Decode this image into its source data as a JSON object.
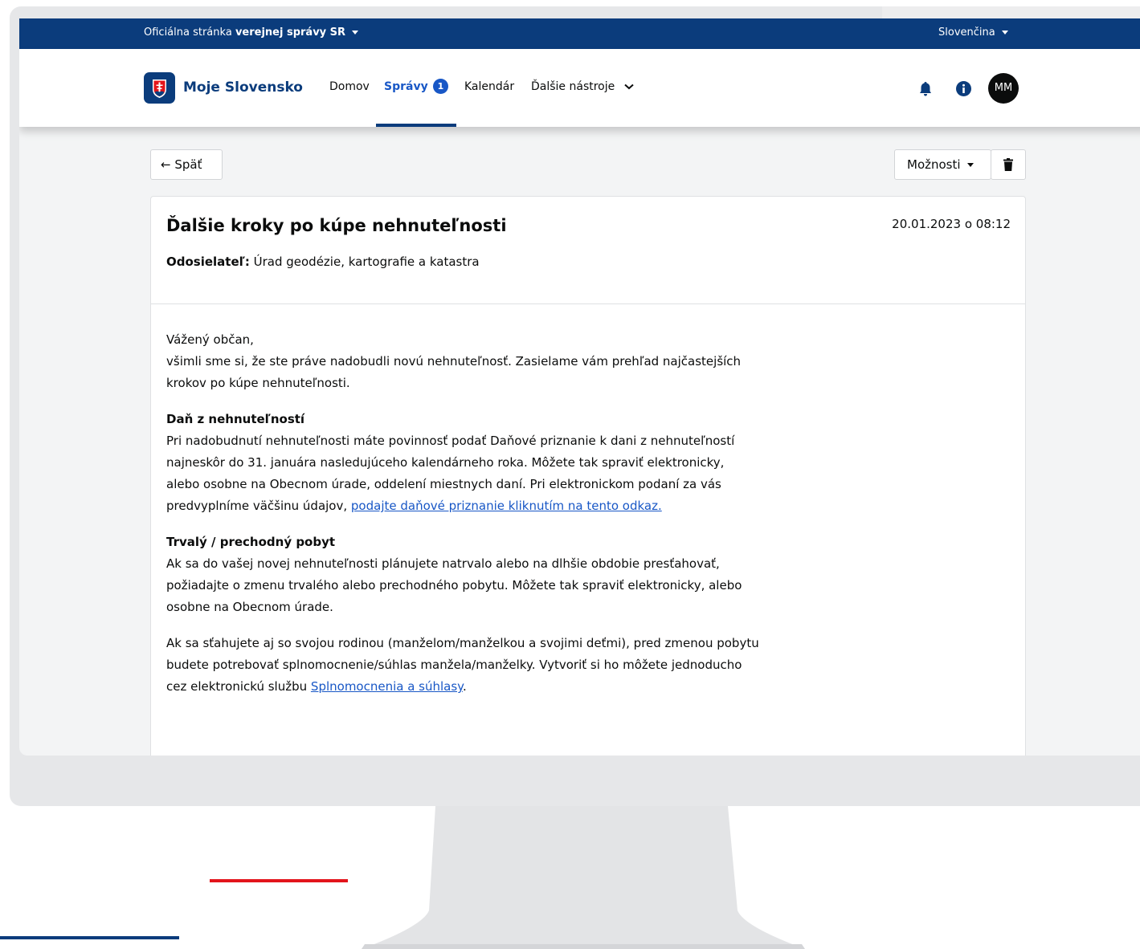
{
  "topbar": {
    "official_prefix": "Oficiálna stránka",
    "official_bold": "verejnej správy SR",
    "language": "Slovenčina"
  },
  "header": {
    "brand": "Moje Slovensko",
    "nav": {
      "home": "Domov",
      "messages": "Správy",
      "messages_badge": "1",
      "calendar": "Kalendár",
      "more_tools": "Ďalšie nástroje"
    },
    "avatar_initials": "MM",
    "icons": [
      "bell-icon",
      "info-icon",
      "chevron-down-icon"
    ],
    "colors": {
      "primary": "#0b3c7c",
      "accent": "#1857c6"
    }
  },
  "actions": {
    "back": "Späť",
    "options": "Možnosti"
  },
  "message": {
    "title": "Ďalšie kroky po kúpe nehnuteľnosti",
    "date": "20.01.2023 o 08:12",
    "sender_label": "Odosielateľ:",
    "sender": "Úrad geodézie, kartografie a katastra",
    "greeting": "Vážený občan,",
    "intro": "všimli sme si, že ste práve nadobudli novú nehnuteľnosť. Zasielame vám prehľad najčastejších krokov po kúpe nehnuteľnosti.",
    "sections": [
      {
        "heading": "Daň z nehnuteľností",
        "text": "Pri nadobudnutí nehnuteľnosti máte povinnosť podať Daňové priznanie k dani z nehnuteľností najneskôr do 31. januára nasledujúceho kalendárneho roka. Môžete tak spraviť elektronicky, alebo osobne na Obecnom úrade, oddelení miestnych daní. Pri elektronickom podaní za vás predvyplníme väčšinu údajov,",
        "link": "podajte daňové priznanie kliknutím na tento odkaz."
      },
      {
        "heading": "Trvalý / prechodný pobyt",
        "text": "Ak sa do vašej novej nehnuteľnosti plánujete natrvalo alebo na dlhšie obdobie presťahovať, požiadajte o zmenu trvalého alebo prechodného pobytu. Môžete tak spraviť elektronicky, alebo osobne na Obecnom úrade."
      }
    ],
    "family_text": "Ak sa sťahujete aj so svojou rodinou (manželom/manželkou a svojimi deťmi), pred zmenou pobytu budete potrebovať splnomocnenie/súhlas manžela/manželky. Vytvoriť si ho môžete jednoducho cez elektronickú službu",
    "family_link": "Splnomocnenia a súhlasy",
    "family_end": "."
  }
}
